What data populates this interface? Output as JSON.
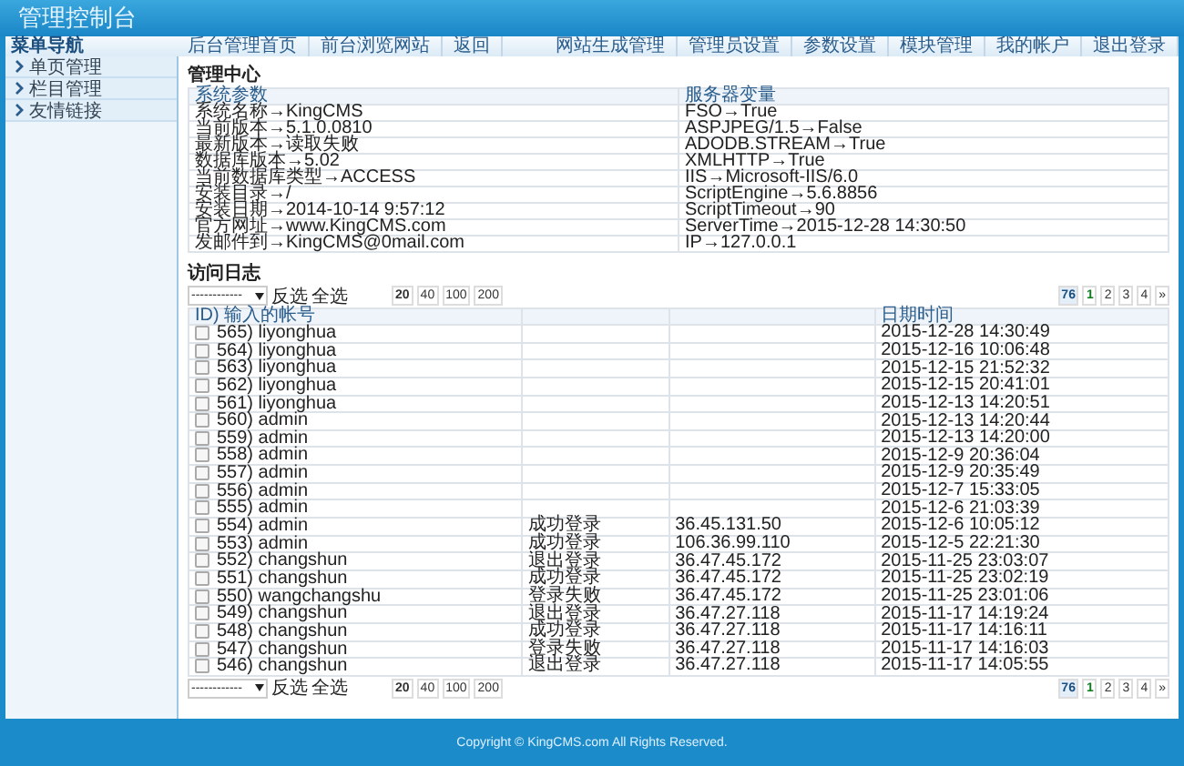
{
  "header": {
    "title": "管理控制台"
  },
  "nav": {
    "menu_title": "菜单导航",
    "left_links": [
      "后台管理首页",
      "前台浏览网站",
      "返回"
    ],
    "right_links": [
      "网站生成管理",
      "管理员设置",
      "参数设置",
      "模块管理",
      "我的帐户",
      "退出登录"
    ]
  },
  "sidebar": {
    "items": [
      {
        "label": "单页管理"
      },
      {
        "label": "栏目管理"
      },
      {
        "label": "友情链接"
      }
    ]
  },
  "info": {
    "title": "管理中心",
    "columns": [
      "系统参数",
      "服务器变量"
    ],
    "rows": [
      [
        "系统名称→KingCMS",
        "FSO→True"
      ],
      [
        "当前版本→5.1.0.0810",
        "ASPJPEG/1.5→False"
      ],
      [
        "最新版本→读取失败",
        "ADODB.STREAM→True"
      ],
      [
        "数据库版本→5.02",
        "XMLHTTP→True"
      ],
      [
        "当前数据库类型→ACCESS",
        "IIS→Microsoft-IIS/6.0"
      ],
      [
        "安装目录→/",
        "ScriptEngine→5.6.8856"
      ],
      [
        "安装日期→2014-10-14 9:57:12",
        "ScriptTimeout→90"
      ],
      [
        "官方网址→www.KingCMS.com",
        "ServerTime→2015-12-28 14:30:50"
      ],
      [
        "发邮件到→KingCMS@0mail.com",
        "IP→127.0.0.1"
      ]
    ]
  },
  "log": {
    "title": "访问日志",
    "top_toolbar": {
      "select": "------------",
      "invert": "反选",
      "select_all": "全选",
      "page_sizes": [
        {
          "label": "20",
          "selected": true
        },
        {
          "label": "40",
          "selected": false
        },
        {
          "label": "100",
          "selected": false
        },
        {
          "label": "200",
          "selected": false
        }
      ],
      "total": "76",
      "pages": [
        {
          "label": "1",
          "selected": true
        },
        {
          "label": "2",
          "selected": false
        },
        {
          "label": "3",
          "selected": false
        },
        {
          "label": "4",
          "selected": false
        }
      ],
      "next": "»"
    },
    "columns": {
      "column_1": "ID) 输入的帐号",
      "column_4": "日期时间"
    },
    "rows": [
      {
        "account": "565) liyonghua",
        "checked": false,
        "date": "2015-12-28 14:30:49"
      },
      {
        "account": "564) liyonghua",
        "checked": false,
        "date": "2015-12-16 10:06:48"
      },
      {
        "account": "563) liyonghua",
        "checked": false,
        "date": "2015-12-15 21:52:32"
      },
      {
        "account": "562) liyonghua",
        "checked": false,
        "date": "2015-12-15 20:41:01"
      },
      {
        "account": "561) liyonghua",
        "checked": false,
        "date": "2015-12-13 14:20:51"
      },
      {
        "account": "560) admin",
        "checked": false,
        "date": "2015-12-13 14:20:44"
      },
      {
        "account": "559) admin",
        "checked": false,
        "date": "2015-12-13 14:20:00"
      },
      {
        "account": "558) admin",
        "checked": false,
        "date": "2015-12-9 20:36:04"
      },
      {
        "account": "557) admin",
        "checked": false,
        "date": "2015-12-9 20:35:49"
      },
      {
        "account": "556) admin",
        "checked": false,
        "date": "2015-12-7 15:33:05"
      },
      {
        "account": "555) admin",
        "checked": false,
        "date": "2015-12-6 21:03:39"
      },
      {
        "account": "554) admin",
        "checked": false,
        "status": "成功登录",
        "ip": "36.45.131.50",
        "date": "2015-12-6 10:05:12"
      },
      {
        "account": "553) admin",
        "checked": false,
        "status": "成功登录",
        "ip": "106.36.99.110",
        "date": "2015-12-5 22:21:30"
      },
      {
        "account": "552) changshun",
        "checked": false,
        "status": "退出登录",
        "ip": "36.47.45.172",
        "date": "2015-11-25 23:03:07"
      },
      {
        "account": "551) changshun",
        "checked": false,
        "status": "成功登录",
        "ip": "36.47.45.172",
        "date": "2015-11-25 23:02:19"
      },
      {
        "account": "550) wangchangshu",
        "checked": false,
        "status": "登录失败",
        "ip": "36.47.45.172",
        "date": "2015-11-25 23:01:06"
      },
      {
        "account": "549) changshun",
        "checked": false,
        "status": "退出登录",
        "ip": "36.47.27.118",
        "date": "2015-11-17 14:19:24"
      },
      {
        "account": "548) changshun",
        "checked": false,
        "status": "成功登录",
        "ip": "36.47.27.118",
        "date": "2015-11-17 14:16:11"
      },
      {
        "account": "547) changshun",
        "checked": false,
        "status": "登录失败",
        "ip": "36.47.27.118",
        "date": "2015-11-17 14:16:03"
      },
      {
        "account": "546) changshun",
        "checked": false,
        "status": "退出登录",
        "ip": "36.47.27.118",
        "date": "2015-11-17 14:05:55"
      }
    ],
    "bottom_toolbar": {
      "select": "------------",
      "invert": "反选",
      "select_all": "全选",
      "page_sizes": [
        {
          "label": "20",
          "selected": true
        },
        {
          "label": "40",
          "selected": false
        },
        {
          "label": "100",
          "selected": false
        },
        {
          "label": "200",
          "selected": false
        }
      ],
      "total": "76",
      "pages": [
        {
          "label": "1",
          "selected": true
        },
        {
          "label": "2",
          "selected": false
        },
        {
          "label": "3",
          "selected": false
        },
        {
          "label": "4",
          "selected": false
        }
      ],
      "next": "»"
    }
  },
  "footer": {
    "copyright": "Copyright © KingCMS.com All Rights Reserved."
  }
}
